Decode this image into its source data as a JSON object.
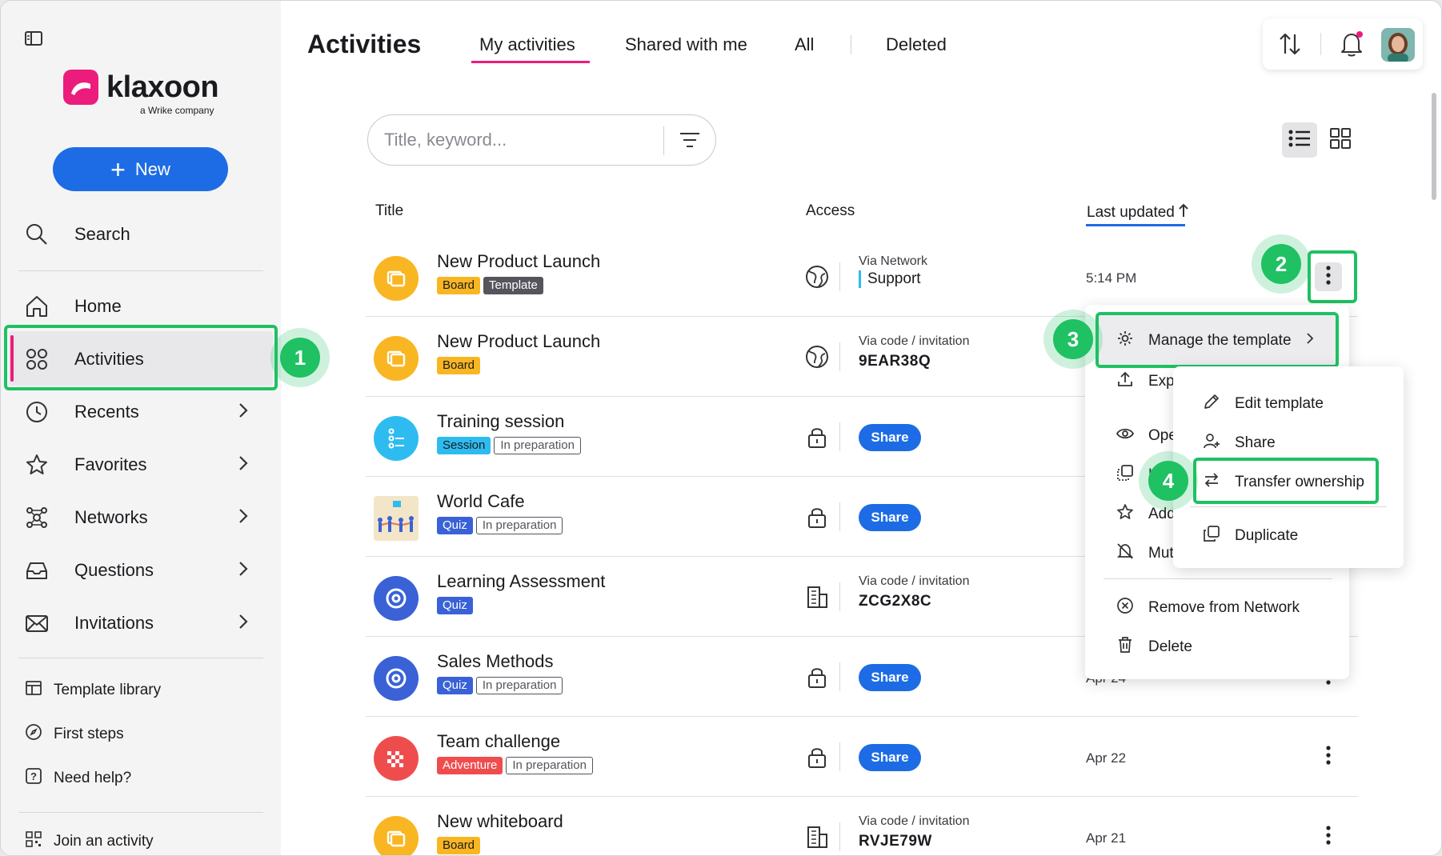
{
  "brand": {
    "name": "klaxoon",
    "sub": "a Wrike company"
  },
  "sidebar": {
    "new_label": "New",
    "search_label": "Search",
    "items": [
      {
        "label": "Home"
      },
      {
        "label": "Activities"
      },
      {
        "label": "Recents"
      },
      {
        "label": "Favorites"
      },
      {
        "label": "Networks"
      },
      {
        "label": "Questions"
      },
      {
        "label": "Invitations"
      }
    ],
    "bottom": [
      {
        "label": "Template library"
      },
      {
        "label": "First steps"
      },
      {
        "label": "Need help?"
      },
      {
        "label": "Join an activity"
      }
    ]
  },
  "header": {
    "title": "Activities",
    "tabs": [
      "My activities",
      "Shared with me",
      "All",
      "Deleted"
    ]
  },
  "search": {
    "placeholder": "Title, keyword..."
  },
  "table": {
    "columns": {
      "title": "Title",
      "access": "Access",
      "updated": "Last updated"
    },
    "rows": [
      {
        "title": "New Product Launch",
        "tags": [
          "Board",
          "Template"
        ],
        "access_label": "Via Network",
        "access_value": "Support",
        "date": "5:14 PM",
        "icon": "board-icon"
      },
      {
        "title": "New Product Launch",
        "tags": [
          "Board"
        ],
        "access_label": "Via code / invitation",
        "access_value": "9EAR38Q",
        "date": "",
        "icon": "board-icon"
      },
      {
        "title": "Training session",
        "tags": [
          "Session",
          "In preparation"
        ],
        "access_label": "",
        "access_value": "Share",
        "date": "",
        "icon": "session-icon"
      },
      {
        "title": "World Cafe",
        "tags": [
          "Quiz",
          "In preparation"
        ],
        "access_label": "",
        "access_value": "Share",
        "date": "",
        "icon": "people-thumbnail"
      },
      {
        "title": "Learning Assessment",
        "tags": [
          "Quiz"
        ],
        "access_label": "Via code / invitation",
        "access_value": "ZCG2X8C",
        "date": "",
        "icon": "quiz-icon"
      },
      {
        "title": "Sales Methods",
        "tags": [
          "Quiz",
          "In preparation"
        ],
        "access_label": "",
        "access_value": "Share",
        "date": "Apr 24",
        "icon": "quiz-icon"
      },
      {
        "title": "Team challenge",
        "tags": [
          "Adventure",
          "In preparation"
        ],
        "access_label": "",
        "access_value": "Share",
        "date": "Apr 22",
        "icon": "adventure-icon"
      },
      {
        "title": "New whiteboard",
        "tags": [
          "Board"
        ],
        "access_label": "Via code / invitation",
        "access_value": "RVJE79W",
        "date": "Apr 21",
        "icon": "board-icon"
      }
    ]
  },
  "menu": {
    "items": [
      "Manage the template",
      "Exp",
      "Ope",
      "U",
      "Add",
      "Mut",
      "Remove from Network",
      "Delete"
    ]
  },
  "submenu": {
    "items": [
      "Edit template",
      "Share",
      "Transfer ownership",
      "Duplicate"
    ]
  },
  "steps": [
    "1",
    "2",
    "3",
    "4"
  ],
  "colors": {
    "accent": "#1d6ce5",
    "brand": "#ec1c7c",
    "highlight": "#1fc162"
  }
}
